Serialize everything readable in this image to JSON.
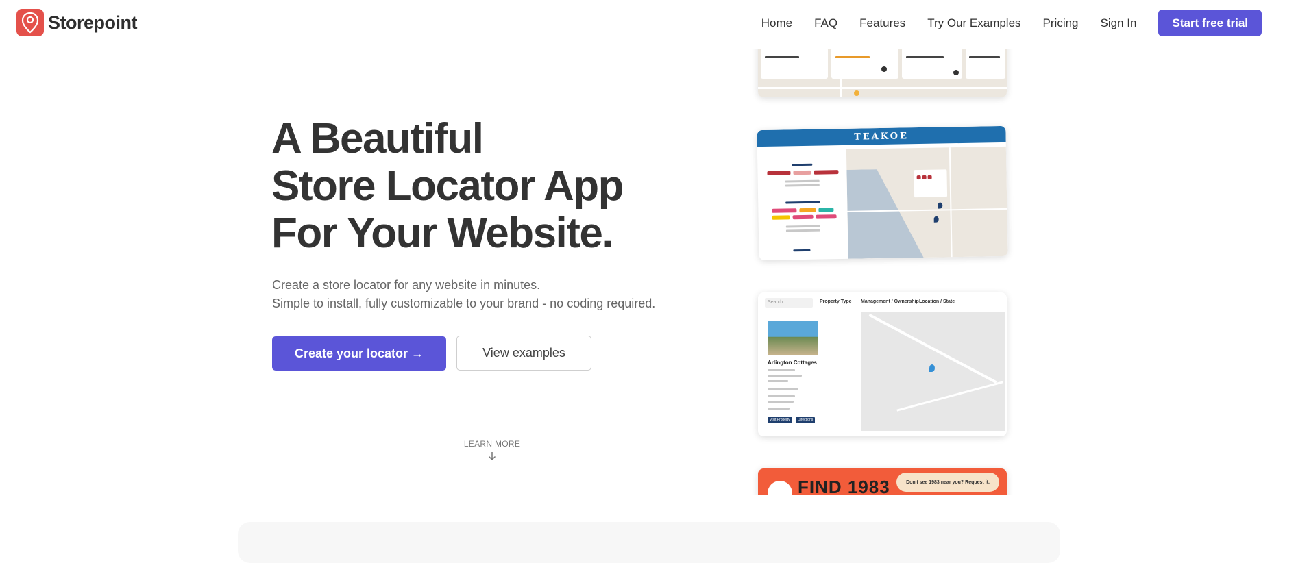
{
  "brand": {
    "name": "Storepoint",
    "accent": "#5b55d8",
    "logo_color": "#e4514b"
  },
  "nav": {
    "links": [
      "Home",
      "FAQ",
      "Features",
      "Try Our Examples",
      "Pricing",
      "Sign In"
    ],
    "cta": "Start free trial"
  },
  "hero": {
    "title_line1": "A Beautiful",
    "title_line2": "Store Locator App",
    "title_line3": "For Your Website.",
    "subtitle_line1": "Create a store locator for any website in minutes.",
    "subtitle_line2": "Simple to install, fully customizable to your brand - no coding required.",
    "primary_button": "Create your locator →",
    "secondary_button": "View examples",
    "learn_more": "LEARN MORE"
  },
  "examples": {
    "teakoe_title": "TEAKOE",
    "property_card": {
      "search_placeholder": "Search",
      "filters": [
        "Property Type",
        "Management / Ownership",
        "Location / State"
      ],
      "listing_name": "Arlington Cottages",
      "buttons": [
        "Visit Property",
        "Directions"
      ]
    },
    "find_banner": "FIND 1983",
    "find_note": "Don't see 1983 near you? Request it."
  }
}
